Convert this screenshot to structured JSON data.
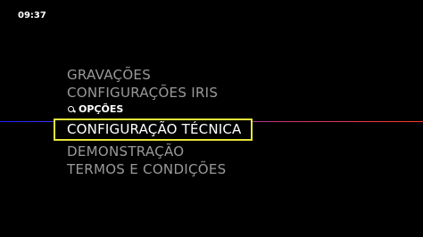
{
  "status_bar": {
    "time": "09:37"
  },
  "colors": {
    "selection_border": "#e8e53a",
    "text_dim": "#9a9a9a",
    "text_active": "#ffffff"
  },
  "menu": {
    "items_before": [
      {
        "label": "GRAVAÇÕES"
      },
      {
        "label": "CONFIGURAÇÕES IRIS"
      }
    ],
    "section": {
      "label": "OPÇÕES",
      "icon": "search-icon"
    },
    "selected": {
      "label": "CONFIGURAÇÃO TÉCNICA"
    },
    "items_after": [
      {
        "label": "DEMONSTRAÇÃO"
      },
      {
        "label": "TERMOS E CONDIÇÕES"
      }
    ]
  }
}
